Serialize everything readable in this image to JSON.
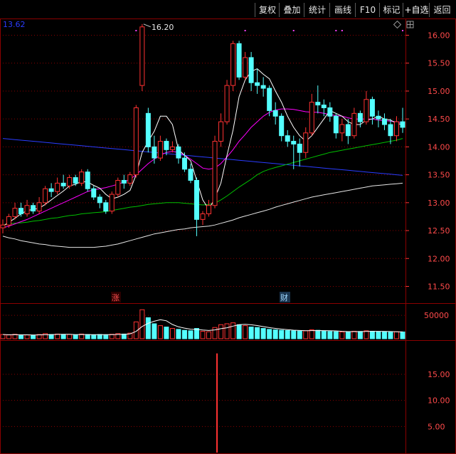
{
  "toolbar": {
    "buttons": [
      "复权",
      "叠加",
      "统计",
      "画线",
      "F10",
      "标记",
      "+自选",
      "返回"
    ],
    "active": "+自选"
  },
  "main_panel": {
    "last_close_label": "13.62",
    "price_ticks": [
      "16.00",
      "15.50",
      "15.00",
      "14.50",
      "14.00",
      "13.50",
      "13.00",
      "12.50",
      "12.00",
      "11.50"
    ],
    "high_marker": "16.20",
    "event_tags": [
      {
        "text": "涨",
        "color": "#ff5050"
      },
      {
        "text": "财",
        "color": "#9fd8ff"
      }
    ]
  },
  "volume_panel": {
    "ticks": [
      "50000"
    ]
  },
  "indicator_panel": {
    "ticks": [
      "15.00",
      "10.00",
      "5.00"
    ]
  },
  "colors": {
    "up": "#ff3232",
    "down": "#54ffff",
    "grid": "#8b0000",
    "ma5": "#ffffff",
    "ma10": "#ffff00",
    "ma20": "#ff00ff",
    "ma60": "#00c000",
    "ma120": "#e6e6e6",
    "ma250": "#2a3cff"
  },
  "chart_data": {
    "type": "candlestick",
    "ylim": [
      11.2,
      16.3
    ],
    "candles": [
      [
        12.55,
        12.6,
        12.45,
        12.7
      ],
      [
        12.6,
        12.75,
        12.55,
        12.8
      ],
      [
        12.75,
        12.9,
        12.7,
        13.0
      ],
      [
        12.9,
        12.8,
        12.75,
        13.0
      ],
      [
        12.8,
        12.95,
        12.75,
        13.05
      ],
      [
        12.95,
        12.85,
        12.8,
        13.0
      ],
      [
        12.85,
        13.0,
        12.8,
        13.1
      ],
      [
        13.0,
        13.25,
        12.95,
        13.3
      ],
      [
        13.25,
        13.2,
        13.1,
        13.35
      ],
      [
        13.2,
        13.35,
        13.15,
        13.45
      ],
      [
        13.35,
        13.3,
        13.25,
        13.5
      ],
      [
        13.3,
        13.45,
        13.25,
        13.5
      ],
      [
        13.45,
        13.35,
        13.3,
        13.5
      ],
      [
        13.35,
        13.55,
        13.3,
        13.6
      ],
      [
        13.55,
        13.25,
        13.2,
        13.6
      ],
      [
        13.25,
        13.1,
        13.05,
        13.3
      ],
      [
        13.1,
        13.0,
        12.9,
        13.15
      ],
      [
        13.0,
        12.85,
        12.8,
        13.05
      ],
      [
        12.85,
        13.15,
        12.8,
        13.2
      ],
      [
        13.15,
        13.4,
        13.1,
        13.45
      ],
      [
        13.4,
        13.35,
        13.25,
        13.5
      ],
      [
        13.35,
        13.5,
        13.3,
        13.55
      ],
      [
        13.5,
        14.7,
        13.45,
        14.75
      ],
      [
        15.1,
        16.15,
        15.0,
        16.2
      ],
      [
        14.6,
        14.0,
        13.9,
        14.7
      ],
      [
        14.0,
        13.8,
        13.7,
        14.2
      ],
      [
        13.8,
        14.1,
        13.75,
        14.2
      ],
      [
        14.1,
        13.95,
        13.85,
        14.15
      ],
      [
        13.95,
        14.0,
        13.9,
        14.1
      ],
      [
        14.0,
        13.8,
        13.7,
        14.05
      ],
      [
        13.8,
        13.6,
        13.55,
        13.9
      ],
      [
        13.6,
        13.4,
        13.35,
        13.7
      ],
      [
        13.4,
        12.7,
        12.4,
        13.45
      ],
      [
        12.7,
        12.8,
        12.6,
        12.85
      ],
      [
        12.8,
        12.95,
        12.75,
        13.05
      ],
      [
        12.95,
        14.1,
        12.9,
        14.2
      ],
      [
        14.1,
        14.45,
        14.0,
        14.6
      ],
      [
        14.45,
        15.1,
        14.4,
        15.2
      ],
      [
        15.1,
        15.85,
        15.0,
        15.9
      ],
      [
        15.85,
        15.25,
        15.2,
        15.9
      ],
      [
        15.25,
        15.6,
        15.2,
        15.7
      ],
      [
        15.6,
        15.15,
        15.0,
        15.7
      ],
      [
        15.15,
        15.1,
        14.95,
        15.4
      ],
      [
        15.1,
        15.05,
        14.9,
        15.25
      ],
      [
        15.05,
        14.65,
        14.55,
        15.1
      ],
      [
        14.65,
        14.55,
        14.4,
        14.8
      ],
      [
        14.55,
        14.2,
        14.1,
        14.6
      ],
      [
        14.2,
        14.1,
        14.0,
        14.3
      ],
      [
        14.1,
        14.05,
        13.6,
        14.2
      ],
      [
        14.05,
        13.9,
        13.65,
        14.15
      ],
      [
        13.9,
        14.25,
        13.8,
        14.35
      ],
      [
        14.25,
        14.8,
        14.2,
        14.95
      ],
      [
        14.8,
        14.75,
        14.6,
        15.1
      ],
      [
        14.75,
        14.7,
        14.55,
        14.85
      ],
      [
        14.7,
        14.55,
        14.45,
        14.8
      ],
      [
        14.55,
        14.25,
        14.15,
        14.6
      ],
      [
        14.25,
        14.4,
        14.1,
        14.5
      ],
      [
        14.4,
        14.2,
        14.05,
        14.5
      ],
      [
        14.2,
        14.6,
        14.15,
        14.7
      ],
      [
        14.6,
        14.45,
        14.35,
        14.65
      ],
      [
        14.45,
        14.85,
        14.4,
        15.0
      ],
      [
        14.85,
        14.55,
        14.4,
        14.9
      ],
      [
        14.55,
        14.5,
        14.35,
        14.65
      ],
      [
        14.5,
        14.4,
        14.3,
        14.6
      ],
      [
        14.4,
        14.2,
        14.05,
        14.5
      ],
      [
        14.2,
        14.45,
        14.1,
        14.55
      ],
      [
        14.45,
        14.35,
        14.25,
        14.7
      ]
    ],
    "ma5": [
      12.58,
      12.65,
      12.72,
      12.8,
      12.86,
      12.88,
      12.9,
      12.97,
      13.05,
      13.13,
      13.21,
      13.3,
      13.33,
      13.38,
      13.37,
      13.31,
      13.26,
      13.15,
      13.07,
      13.1,
      13.15,
      13.22,
      13.5,
      13.9,
      14.1,
      14.28,
      14.55,
      14.55,
      14.4,
      13.95,
      13.85,
      13.75,
      13.4,
      13.05,
      12.88,
      13.08,
      13.35,
      13.85,
      14.3,
      14.9,
      15.2,
      15.35,
      15.4,
      15.3,
      15.22,
      15.0,
      14.8,
      14.55,
      14.35,
      14.2,
      14.1,
      14.2,
      14.35,
      14.5,
      14.65,
      14.6,
      14.55,
      14.45,
      14.4,
      14.4,
      14.48,
      14.5,
      14.55,
      14.5,
      14.48,
      14.42,
      14.4
    ],
    "ma20": [
      12.55,
      12.58,
      12.62,
      12.66,
      12.7,
      12.75,
      12.8,
      12.85,
      12.9,
      12.95,
      13.0,
      13.05,
      13.1,
      13.15,
      13.2,
      13.23,
      13.25,
      13.27,
      13.3,
      13.33,
      13.37,
      13.42,
      13.5,
      13.6,
      13.7,
      13.78,
      13.85,
      13.9,
      13.92,
      13.9,
      13.85,
      13.78,
      13.7,
      13.62,
      13.6,
      13.62,
      13.7,
      13.82,
      13.95,
      14.1,
      14.22,
      14.35,
      14.45,
      14.55,
      14.62,
      14.66,
      14.68,
      14.68,
      14.67,
      14.65,
      14.63,
      14.62,
      14.62,
      14.6,
      14.58,
      14.56,
      14.55,
      14.52,
      14.5,
      14.5,
      14.5,
      14.5,
      14.48,
      14.47,
      14.46,
      14.45,
      14.43
    ],
    "ma60": [
      12.6,
      12.62,
      12.63,
      12.64,
      12.65,
      12.67,
      12.68,
      12.7,
      12.72,
      12.73,
      12.75,
      12.77,
      12.78,
      12.8,
      12.81,
      12.82,
      12.83,
      12.84,
      12.86,
      12.88,
      12.9,
      12.92,
      12.93,
      12.95,
      12.97,
      12.98,
      12.99,
      13.0,
      13.0,
      13.0,
      12.99,
      12.98,
      12.97,
      12.96,
      12.97,
      12.99,
      13.05,
      13.12,
      13.2,
      13.28,
      13.35,
      13.42,
      13.5,
      13.56,
      13.6,
      13.63,
      13.66,
      13.69,
      13.72,
      13.75,
      13.78,
      13.81,
      13.84,
      13.87,
      13.9,
      13.92,
      13.94,
      13.96,
      13.98,
      14.0,
      14.02,
      14.04,
      14.06,
      14.08,
      14.1,
      14.12,
      14.15
    ],
    "ma120": [
      12.4,
      12.37,
      12.35,
      12.32,
      12.3,
      12.28,
      12.26,
      12.25,
      12.23,
      12.22,
      12.21,
      12.2,
      12.2,
      12.2,
      12.2,
      12.2,
      12.21,
      12.22,
      12.24,
      12.26,
      12.29,
      12.32,
      12.35,
      12.38,
      12.41,
      12.44,
      12.46,
      12.48,
      12.5,
      12.52,
      12.53,
      12.55,
      12.56,
      12.57,
      12.58,
      12.6,
      12.63,
      12.66,
      12.69,
      12.73,
      12.76,
      12.79,
      12.82,
      12.85,
      12.88,
      12.92,
      12.95,
      12.98,
      13.01,
      13.04,
      13.07,
      13.1,
      13.12,
      13.14,
      13.16,
      13.18,
      13.2,
      13.22,
      13.24,
      13.26,
      13.28,
      13.3,
      13.31,
      13.32,
      13.33,
      13.34,
      13.35
    ],
    "ma250": [
      14.15,
      14.14,
      14.13,
      14.12,
      14.11,
      14.1,
      14.09,
      14.08,
      14.07,
      14.06,
      14.05,
      14.04,
      14.03,
      14.02,
      14.01,
      14.0,
      13.99,
      13.98,
      13.97,
      13.96,
      13.95,
      13.94,
      13.93,
      13.92,
      13.91,
      13.9,
      13.89,
      13.88,
      13.87,
      13.86,
      13.85,
      13.84,
      13.83,
      13.82,
      13.81,
      13.8,
      13.79,
      13.78,
      13.77,
      13.76,
      13.75,
      13.74,
      13.73,
      13.72,
      13.71,
      13.7,
      13.69,
      13.68,
      13.67,
      13.66,
      13.65,
      13.64,
      13.63,
      13.62,
      13.61,
      13.6,
      13.59,
      13.58,
      13.57,
      13.56,
      13.55,
      13.54,
      13.53,
      13.52,
      13.51,
      13.5,
      13.49
    ],
    "volume": [
      9000,
      8000,
      9500,
      7000,
      8000,
      7500,
      9000,
      11000,
      9000,
      10000,
      8500,
      9000,
      8000,
      10000,
      9000,
      8000,
      9000,
      8500,
      9500,
      11000,
      10000,
      12000,
      36000,
      62000,
      45000,
      32000,
      28000,
      25000,
      22000,
      20000,
      18000,
      17000,
      22000,
      16000,
      15000,
      24000,
      30000,
      32000,
      34000,
      30000,
      28000,
      25000,
      24000,
      22000,
      20000,
      19000,
      18000,
      17500,
      17000,
      16500,
      17000,
      19000,
      18000,
      16000,
      15500,
      15000,
      14500,
      15000,
      16000,
      15500,
      17000,
      16000,
      15000,
      14500,
      14000,
      15000,
      14500
    ],
    "volume_ylim": [
      0,
      70000
    ],
    "indicator": {
      "bar_index": 35,
      "value": 19.0,
      "ylim": [
        0,
        21
      ]
    }
  }
}
